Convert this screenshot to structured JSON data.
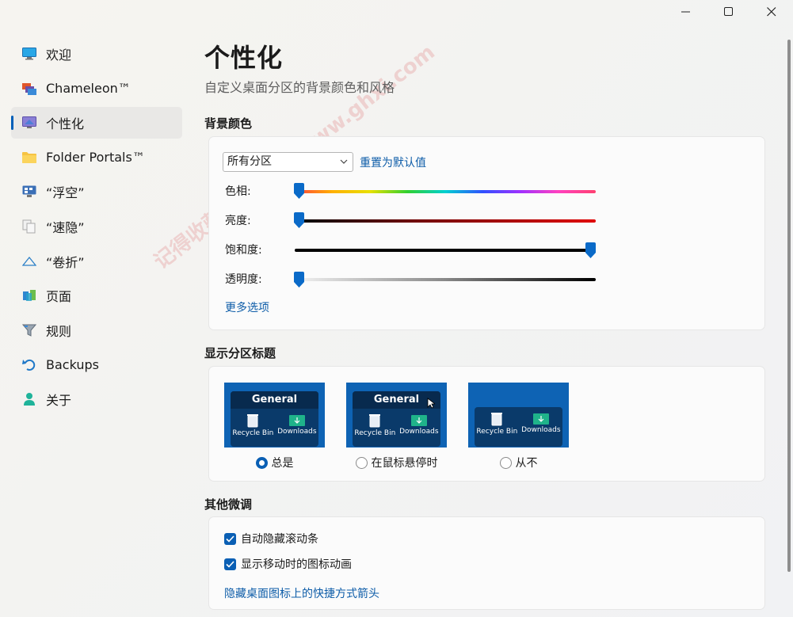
{
  "window": {
    "controls": [
      "minimize-icon",
      "maximize-icon",
      "close-icon"
    ]
  },
  "sidebar": {
    "items": [
      {
        "label": "欢迎",
        "icon": "monitor-icon"
      },
      {
        "label": "Chameleon™",
        "icon": "chameleon-icon"
      },
      {
        "label": "个性化",
        "icon": "personalize-icon",
        "active": true
      },
      {
        "label": "Folder Portals™",
        "icon": "folder-icon"
      },
      {
        "label": "“浮空”",
        "icon": "desktop-float-icon"
      },
      {
        "label": "“速隐”",
        "icon": "quick-hide-icon"
      },
      {
        "label": "“卷折”",
        "icon": "rollup-icon"
      },
      {
        "label": "页面",
        "icon": "pages-icon"
      },
      {
        "label": "规则",
        "icon": "rules-funnel-icon"
      },
      {
        "label": "Backups",
        "icon": "backup-undo-icon"
      },
      {
        "label": "关于",
        "icon": "person-icon"
      }
    ]
  },
  "main": {
    "title": "个性化",
    "subtitle": "自定义桌面分区的背景颜色和风格",
    "background_color": {
      "heading": "背景颜色",
      "partition_select": "所有分区",
      "reset_link": "重置为默认值",
      "sliders": [
        {
          "label": "色相:",
          "level": 0.0
        },
        {
          "label": "亮度:",
          "level": 0.0
        },
        {
          "label": "饱和度:",
          "level": 1.0
        },
        {
          "label": "透明度:",
          "level": 0.0
        }
      ],
      "more_link": "更多选项"
    },
    "title_display": {
      "heading": "显示分区标题",
      "options": [
        {
          "label": "总是",
          "checked": true,
          "preview_title": "General"
        },
        {
          "label": "在鼠标悬停时",
          "checked": false,
          "preview_title": "General"
        },
        {
          "label": "从不",
          "checked": false,
          "preview_title": ""
        }
      ],
      "preview_items": [
        "Recycle Bin",
        "Downloads"
      ]
    },
    "tweaks": {
      "heading": "其他微调",
      "checks": [
        {
          "label": "自动隐藏滚动条",
          "checked": true
        },
        {
          "label": "显示移动时的图标动画",
          "checked": true
        }
      ],
      "link": "隐藏桌面图标上的快捷方式箭头"
    }
  },
  "watermark": "记得收藏:果核剥壳 www.ghxi.com",
  "colors": {
    "accent": "#005fb8",
    "link": "#0d5ca8",
    "preview_blue": "#0e63b4"
  }
}
